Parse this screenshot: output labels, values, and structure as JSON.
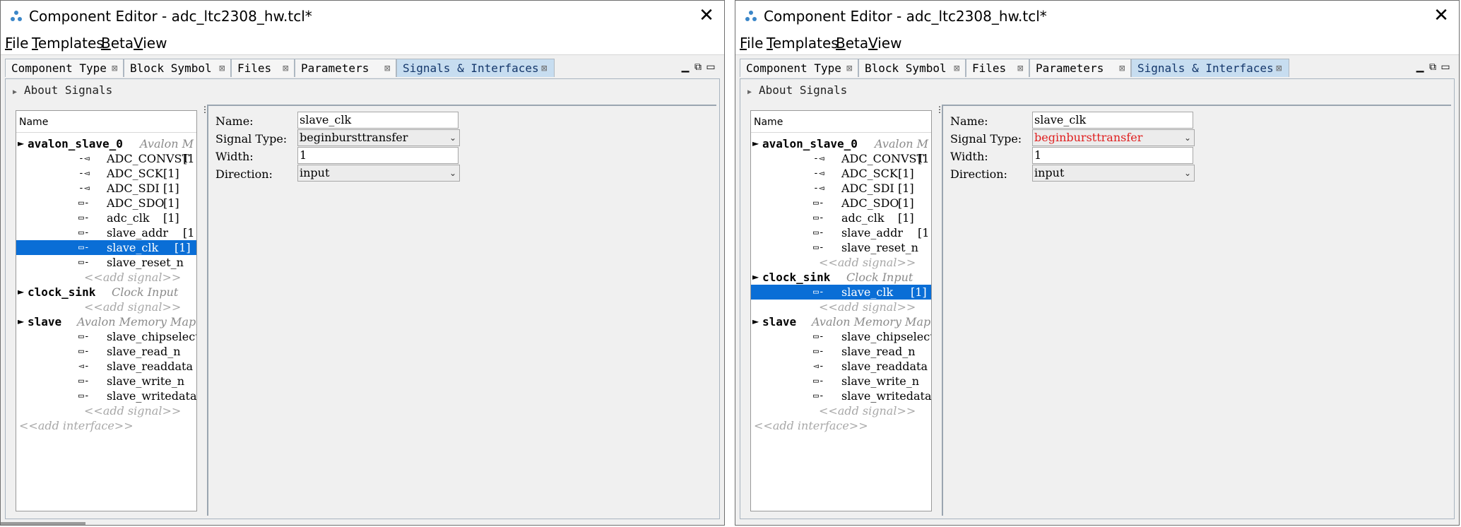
{
  "windows": [
    {
      "title": "Component Editor - adc_ltc2308_hw.tcl*",
      "menu": [
        {
          "key": "F",
          "rest": "ile"
        },
        {
          "key": "T",
          "rest": "emplates"
        },
        {
          "key": "B",
          "rest": "eta"
        },
        {
          "key": "V",
          "rest": "iew"
        }
      ],
      "tabs": [
        "Component Type",
        "Block Symbol",
        "Files",
        "Parameters",
        "Signals & Interfaces"
      ],
      "active_tab": "Signals & Interfaces",
      "about": "About Signals",
      "tree_header": "Name",
      "tree": {
        "if1_name": "avalon_slave_0",
        "if1_type": "Avalon  M",
        "if1_signals": [
          {
            "icon": "-◅",
            "name": "ADC_CONVST",
            "width": "[1"
          },
          {
            "icon": "-◅",
            "name": "ADC_SCK",
            "width": "[1]"
          },
          {
            "icon": "-◅",
            "name": "ADC_SDI",
            "width": "[1]"
          },
          {
            "icon": "▭-",
            "name": "ADC_SDO",
            "width": "[1]"
          },
          {
            "icon": "▭-",
            "name": "adc_clk",
            "width": "[1]"
          },
          {
            "icon": "▭-",
            "name": "slave_addr",
            "width": "[1"
          },
          {
            "icon": "▭-",
            "name": "slave_clk",
            "width": "[1]"
          },
          {
            "icon": "▭-",
            "name": "slave_reset_n",
            "width": ""
          }
        ],
        "add_signal": "<<add  signal>>",
        "if2_name": "clock_sink",
        "if2_type": "Clock  Input",
        "if3_name": "slave",
        "if3_type": "Avalon  Memory  Map",
        "if3_signals": [
          {
            "icon": "▭-",
            "name": "slave_chipselect"
          },
          {
            "icon": "▭-",
            "name": "slave_read_n"
          },
          {
            "icon": "◅-",
            "name": "slave_readdata"
          },
          {
            "icon": "▭-",
            "name": "slave_write_n"
          },
          {
            "icon": "▭-",
            "name": "slave_writedata"
          }
        ],
        "add_interface": "<<add  interface>>"
      },
      "fields": {
        "name_label": "Name:",
        "name_value": "slave_clk",
        "type_label": "Signal Type:",
        "type_value": "beginbursttransfer",
        "width_label": "Width:",
        "width_value": "1",
        "dir_label": "Direction:",
        "dir_value": "input"
      }
    },
    {
      "title": "Component Editor - adc_ltc2308_hw.tcl*",
      "menu": [
        {
          "key": "F",
          "rest": "ile"
        },
        {
          "key": "T",
          "rest": "emplates"
        },
        {
          "key": "B",
          "rest": "eta"
        },
        {
          "key": "V",
          "rest": "iew"
        }
      ],
      "tabs": [
        "Component Type",
        "Block Symbol",
        "Files",
        "Parameters",
        "Signals & Interfaces"
      ],
      "active_tab": "Signals & Interfaces",
      "about": "About Signals",
      "tree_header": "Name",
      "tree": {
        "if1_name": "avalon_slave_0",
        "if1_type": "Avalon  M",
        "if1_signals": [
          {
            "icon": "-◅",
            "name": "ADC_CONVST",
            "width": "[1"
          },
          {
            "icon": "-◅",
            "name": "ADC_SCK",
            "width": "[1]"
          },
          {
            "icon": "-◅",
            "name": "ADC_SDI",
            "width": "[1]"
          },
          {
            "icon": "▭-",
            "name": "ADC_SDO",
            "width": "[1]"
          },
          {
            "icon": "▭-",
            "name": "adc_clk",
            "width": "[1]"
          },
          {
            "icon": "▭-",
            "name": "slave_addr",
            "width": "[1"
          },
          {
            "icon": "▭-",
            "name": "slave_reset_n",
            "width": ""
          }
        ],
        "add_signal": "<<add  signal>>",
        "if2_name": "clock_sink",
        "if2_type": "Clock  Input",
        "if2_signal": {
          "icon": "▭-",
          "name": "slave_clk",
          "width": "[1]"
        },
        "if3_name": "slave",
        "if3_type": "Avalon  Memory  Map",
        "if3_signals": [
          {
            "icon": "▭-",
            "name": "slave_chipselect"
          },
          {
            "icon": "▭-",
            "name": "slave_read_n"
          },
          {
            "icon": "◅-",
            "name": "slave_readdata"
          },
          {
            "icon": "▭-",
            "name": "slave_write_n"
          },
          {
            "icon": "▭-",
            "name": "slave_writedata"
          }
        ],
        "add_interface": "<<add  interface>>"
      },
      "fields": {
        "name_label": "Name:",
        "name_value": "slave_clk",
        "type_label": "Signal Type:",
        "type_value": "beginbursttransfer",
        "width_label": "Width:",
        "width_value": "1",
        "dir_label": "Direction:",
        "dir_value": "input"
      }
    }
  ],
  "colors": {
    "selection": "#0a6ed6",
    "active_tab": "#c7ddf0",
    "error_text": "#e02020"
  }
}
